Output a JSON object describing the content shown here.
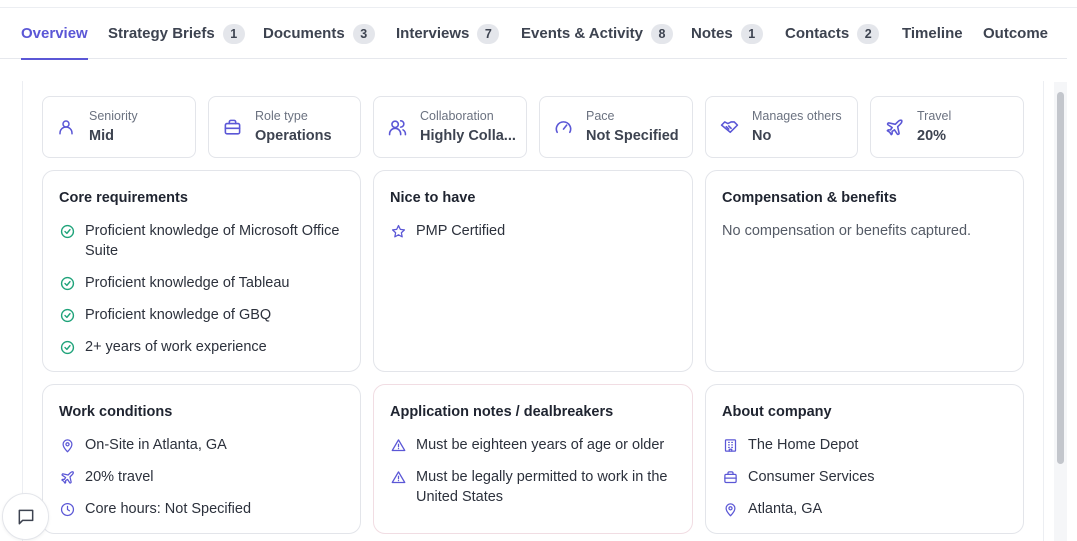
{
  "tabs": [
    {
      "label": "Overview",
      "count": null
    },
    {
      "label": "Strategy Briefs",
      "count": "1"
    },
    {
      "label": "Documents",
      "count": "3"
    },
    {
      "label": "Interviews",
      "count": "7"
    },
    {
      "label": "Events & Activity",
      "count": "8"
    },
    {
      "label": "Notes",
      "count": "1"
    },
    {
      "label": "Contacts",
      "count": "2"
    },
    {
      "label": "Timeline",
      "count": null
    },
    {
      "label": "Outcome",
      "count": null
    }
  ],
  "active_tab": "Overview",
  "stats": [
    {
      "label": "Seniority",
      "value": "Mid",
      "icon": "user-icon"
    },
    {
      "label": "Role type",
      "value": "Operations",
      "icon": "briefcase-icon"
    },
    {
      "label": "Collaboration",
      "value": "Highly Colla...",
      "icon": "users-icon"
    },
    {
      "label": "Pace",
      "value": "Not Specified",
      "icon": "gauge-icon"
    },
    {
      "label": "Manages others",
      "value": "No",
      "icon": "handshake-icon"
    },
    {
      "label": "Travel",
      "value": "20%",
      "icon": "plane-icon"
    }
  ],
  "core": {
    "title": "Core requirements",
    "items": [
      "Proficient knowledge of Microsoft Office Suite",
      "Proficient knowledge of Tableau",
      "Proficient knowledge of GBQ",
      "2+ years of work experience"
    ]
  },
  "nice": {
    "title": "Nice to have",
    "items": [
      "PMP Certified"
    ]
  },
  "comp": {
    "title": "Compensation & benefits",
    "empty": "No compensation or benefits captured."
  },
  "work": {
    "title": "Work conditions",
    "location": "On-Site in Atlanta, GA",
    "travel": "20% travel",
    "hours": "Core hours: Not Specified"
  },
  "notes": {
    "title": "Application notes / dealbreakers",
    "items": [
      "Must be eighteen years of age or older",
      "Must be legally permitted to work in the United States"
    ]
  },
  "company": {
    "title": "About company",
    "name": "The Home Depot",
    "industry": "Consumer Services",
    "location": "Atlanta, GA"
  },
  "colors": {
    "accent": "#5b57d6",
    "success": "#1fa37a",
    "text": "#1f2430",
    "muted": "#6b7280"
  }
}
